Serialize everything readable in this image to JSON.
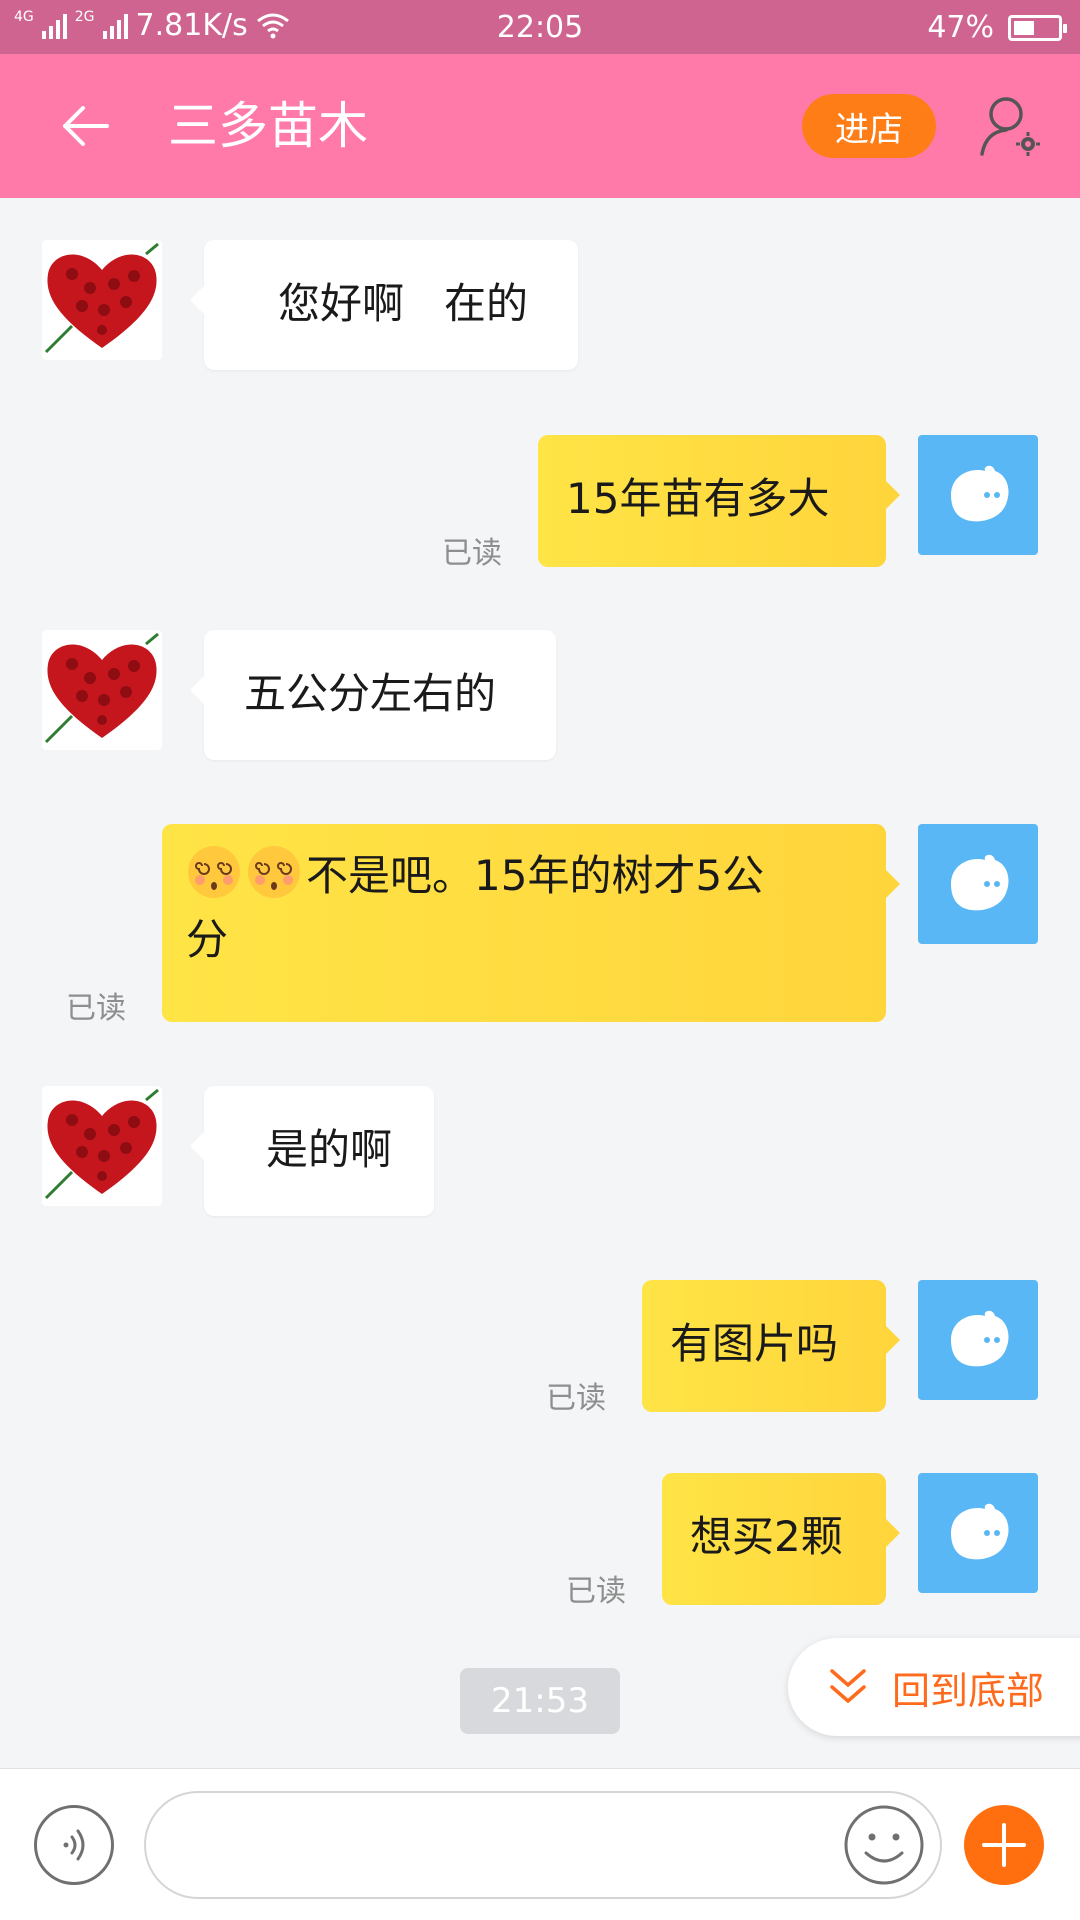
{
  "status_bar": {
    "network_1": "4G",
    "network_2": "2G",
    "speed": "7.81K/s",
    "time": "22:05",
    "battery_percent": "47%",
    "battery_level": 0.47
  },
  "header": {
    "title": "三多苗木",
    "store_button": "进店"
  },
  "messages": [
    {
      "from": "seller",
      "text": "您好啊   在的"
    },
    {
      "from": "me",
      "text": "15年苗有多大",
      "status": "已读"
    },
    {
      "from": "seller",
      "text": "五公分左右的"
    },
    {
      "from": "me",
      "text_line1": "不是吧。15年的树才5公",
      "text_line2": "分",
      "emoji": "dizzy-face-emoji",
      "status": "已读"
    },
    {
      "from": "seller",
      "text": "是的啊"
    },
    {
      "from": "me",
      "text": "有图片吗",
      "status": "已读"
    },
    {
      "from": "me",
      "text": "想买2颗",
      "status": "已读"
    }
  ],
  "timestamp": "21:53",
  "scroll_to_bottom": "回到底部",
  "input": {
    "value": "",
    "placeholder": ""
  },
  "colors": {
    "status_bar": "#cf6490",
    "header": "#ff7aa8",
    "store_button": "#ff7d16",
    "outgoing_bubble": "#ffdc40",
    "my_avatar": "#5ab7f5",
    "accent": "#ff6a1c"
  }
}
